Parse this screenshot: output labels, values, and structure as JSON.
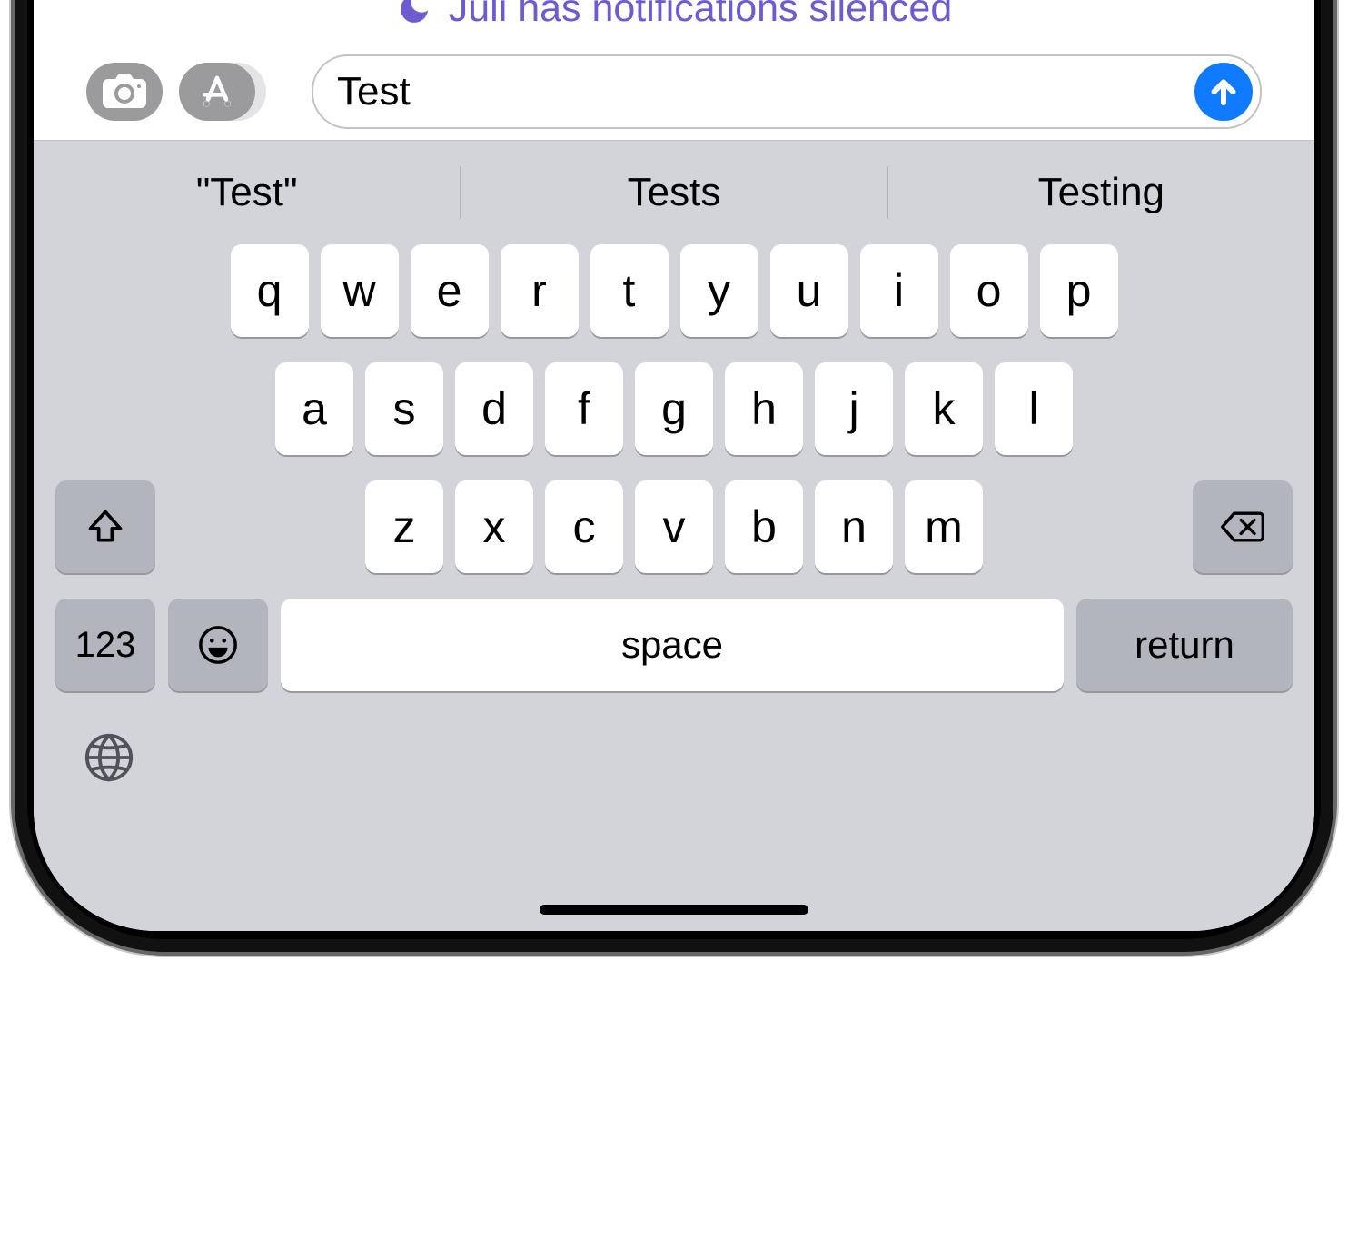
{
  "notification": {
    "text": "Juli has notifications silenced"
  },
  "compose": {
    "value": "Test"
  },
  "suggestions": [
    "\"Test\"",
    "Tests",
    "Testing"
  ],
  "keyboard": {
    "row1": [
      "q",
      "w",
      "e",
      "r",
      "t",
      "y",
      "u",
      "i",
      "o",
      "p"
    ],
    "row2": [
      "a",
      "s",
      "d",
      "f",
      "g",
      "h",
      "j",
      "k",
      "l"
    ],
    "row3": [
      "z",
      "x",
      "c",
      "v",
      "b",
      "n",
      "m"
    ],
    "numbers_label": "123",
    "space_label": "space",
    "return_label": "return"
  }
}
